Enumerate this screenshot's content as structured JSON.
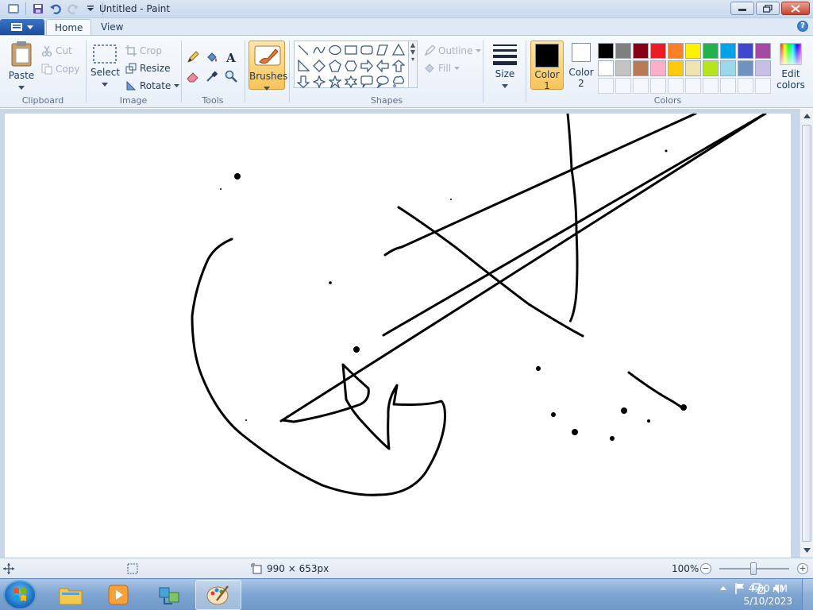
{
  "window": {
    "title": "Untitled - Paint"
  },
  "tabs": {
    "home": "Home",
    "view": "View"
  },
  "clipboard": {
    "paste": "Paste",
    "cut": "Cut",
    "copy": "Copy",
    "label": "Clipboard"
  },
  "image": {
    "select": "Select",
    "crop": "Crop",
    "resize": "Resize",
    "rotate": "Rotate",
    "label": "Image"
  },
  "tools": {
    "label": "Tools"
  },
  "brushes": {
    "label": "Brushes"
  },
  "shapes": {
    "outline": "Outline",
    "fill": "Fill",
    "label": "Shapes"
  },
  "size": {
    "label": "Size"
  },
  "colors": {
    "color1_label": "Color",
    "color1_num": "1",
    "color2_label": "Color",
    "color2_num": "2",
    "edit_label": "Edit",
    "edit_label2": "colors",
    "label": "Colors",
    "color1_value": "#000000",
    "color2_value": "#ffffff",
    "palette_row1": [
      "#000000",
      "#7f7f7f",
      "#880015",
      "#ed1c24",
      "#ff7f27",
      "#fff200",
      "#22b14c",
      "#00a2e8",
      "#3f48cc",
      "#a349a4"
    ],
    "palette_row2": [
      "#ffffff",
      "#c3c3c3",
      "#b97a57",
      "#ffaec9",
      "#ffc90e",
      "#efe4b0",
      "#b5e61d",
      "#99d9ea",
      "#7092be",
      "#c8bfe7"
    ]
  },
  "status": {
    "canvas_size": "990 × 653px",
    "zoom": "100%"
  },
  "taskbar": {
    "time": "4:00 AM",
    "date": "5/10/2023"
  }
}
